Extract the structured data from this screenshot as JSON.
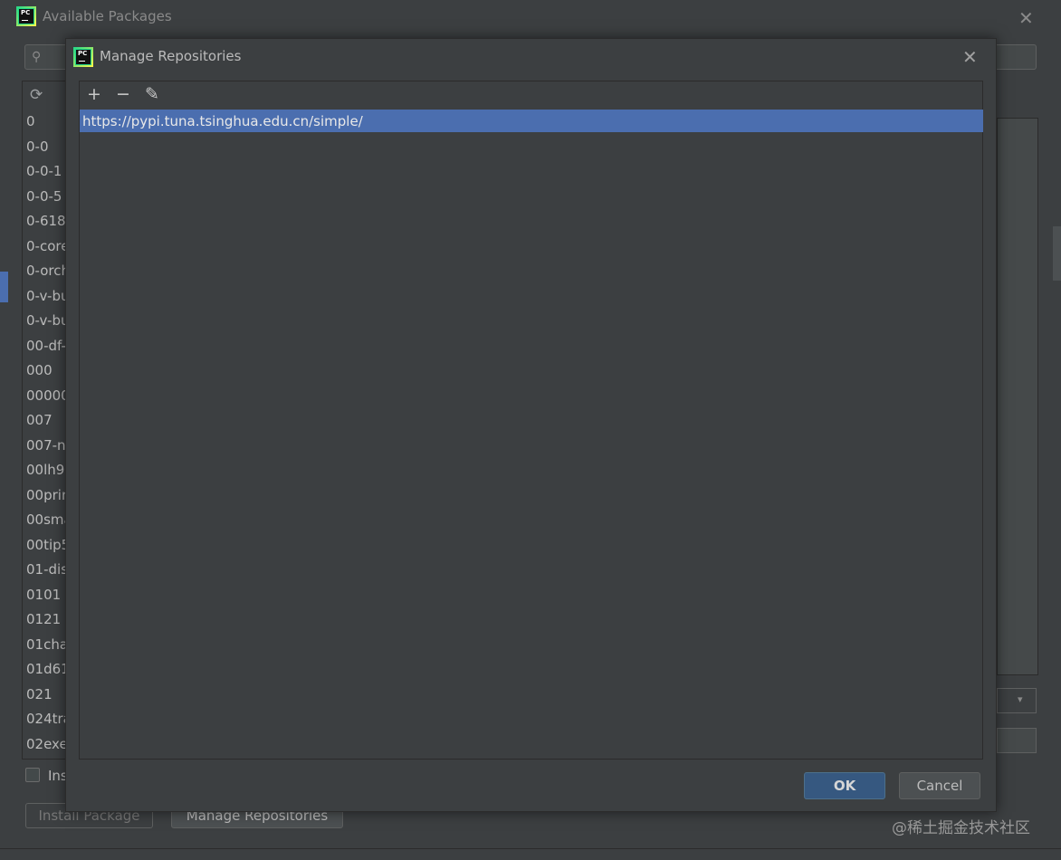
{
  "outer": {
    "title": "Available Packages",
    "close_glyph": "✕",
    "search_glyph": "⚲",
    "refresh_glyph": "⟳",
    "packages": [
      "0",
      "0-0",
      "0-0-1",
      "0-0-5",
      "0-618",
      "0-core",
      "0-orch",
      "0-v-bu",
      "0-v-bu",
      "00-df-",
      "000",
      "00000",
      "007",
      "007-n",
      "00lh9l",
      "00prin",
      "00sma",
      "00tip5",
      "01-dis",
      "0101",
      "0121",
      "01cha",
      "01d61",
      "021",
      "024tra",
      "02exe"
    ],
    "install_checkbox_label": "Ins",
    "install_button": "Install Package",
    "manage_button": "Manage Repositories",
    "select_arrow": "▾"
  },
  "dialog": {
    "title": "Manage Repositories",
    "close_glyph": "✕",
    "toolbar": {
      "add": "+",
      "remove": "−",
      "edit": "✎"
    },
    "repositories": [
      "https://pypi.tuna.tsinghua.edu.cn/simple/"
    ],
    "ok_label": "OK",
    "cancel_label": "Cancel"
  },
  "watermark": "@稀土掘金技术社区",
  "colors": {
    "accent": "#4b6eaf",
    "ok_button": "#365880",
    "background": "#3c3f41"
  }
}
